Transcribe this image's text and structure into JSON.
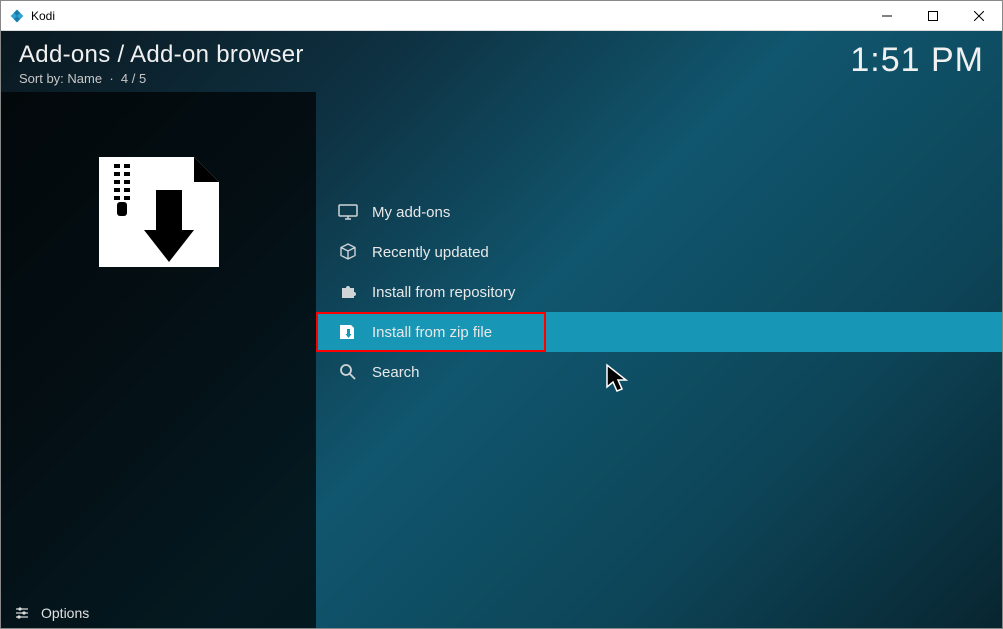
{
  "window": {
    "title": "Kodi"
  },
  "header": {
    "breadcrumb": "Add-ons / Add-on browser",
    "sort_label": "Sort by: Name",
    "counter": "4 / 5",
    "clock": "1:51 PM"
  },
  "list": {
    "items": [
      {
        "label": "My add-ons",
        "icon": "monitor-icon"
      },
      {
        "label": "Recently updated",
        "icon": "package-icon"
      },
      {
        "label": "Install from repository",
        "icon": "puzzle-icon"
      },
      {
        "label": "Install from zip file",
        "icon": "zip-icon"
      },
      {
        "label": "Search",
        "icon": "search-icon"
      }
    ],
    "selected_index": 3
  },
  "footer": {
    "options_label": "Options"
  }
}
